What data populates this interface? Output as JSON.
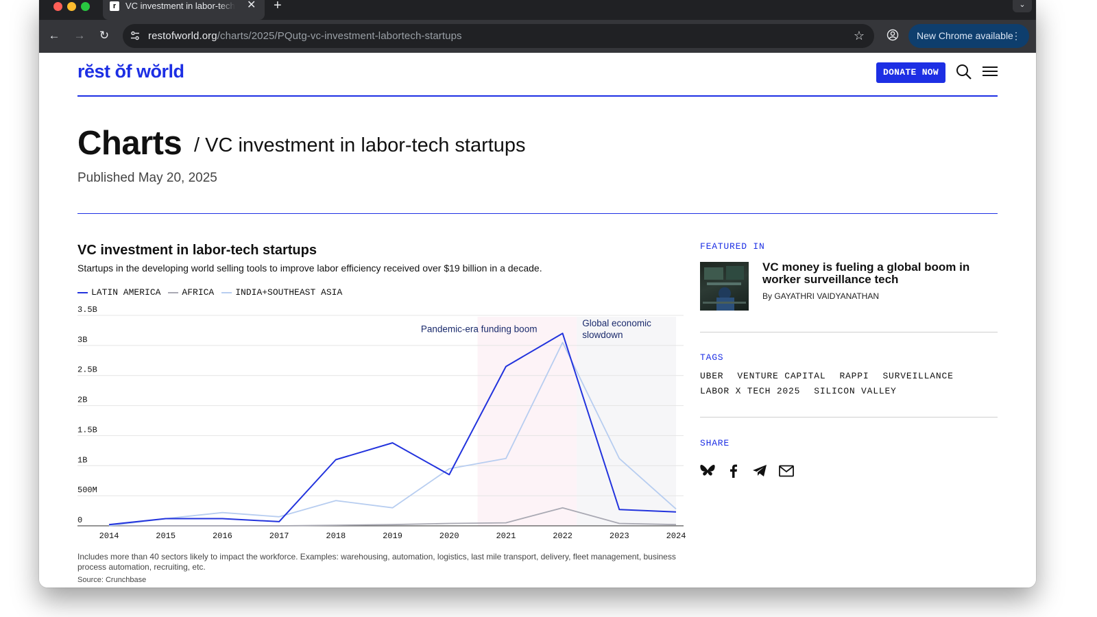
{
  "browser": {
    "tab_title": "VC investment in labor-tech startups",
    "tab_favicon": "r",
    "url_host": "restofworld.org",
    "url_path": "/charts/2025/PQutg-vc-investment-labortech-startups",
    "update_label": "New Chrome available",
    "icons": [
      "back-icon",
      "forward-icon",
      "reload-icon",
      "tune-icon",
      "star-icon",
      "profile-icon",
      "more-icon"
    ]
  },
  "site": {
    "logo": "rĕst ŏf wŏrld",
    "donate_label": "DONATE NOW",
    "icons": [
      "search-icon",
      "menu-icon"
    ],
    "brand_color": "#1d2fe4"
  },
  "header": {
    "title": "Charts",
    "subtitle": "/ VC investment in labor-tech startups",
    "published": "Published May 20, 2025"
  },
  "chart_data": {
    "type": "line",
    "title": "VC investment in labor-tech startups",
    "subtitle": "Startups in the developing world selling tools to improve labor efficiency received over $19 billion in a decade.",
    "x": [
      2014,
      2015,
      2016,
      2017,
      2018,
      2019,
      2020,
      2021,
      2022,
      2023,
      2024
    ],
    "series": [
      {
        "name": "LATIN AMERICA",
        "color": "#2233dd",
        "values": [
          0.02,
          0.12,
          0.12,
          0.07,
          1.1,
          1.38,
          0.85,
          2.65,
          3.2,
          0.27,
          0.23
        ]
      },
      {
        "name": "AFRICA",
        "color": "#a9a9b3",
        "values": [
          0.0,
          0.0,
          0.0,
          0.0,
          0.01,
          0.02,
          0.04,
          0.05,
          0.3,
          0.04,
          0.02
        ]
      },
      {
        "name": "INDIA+SOUTHEAST ASIA",
        "color": "#b7cdf0",
        "values": [
          0.0,
          0.12,
          0.22,
          0.15,
          0.42,
          0.3,
          0.95,
          1.12,
          3.05,
          1.12,
          0.28
        ]
      }
    ],
    "yticks": [
      "0",
      "500M",
      "1B",
      "1.5B",
      "2B",
      "2.5B",
      "3B",
      "3.5B"
    ],
    "ytick_values": [
      0,
      0.5,
      1.0,
      1.5,
      2.0,
      2.5,
      3.0,
      3.5
    ],
    "ylim": [
      0,
      3.5
    ],
    "xlim": [
      2014,
      2024
    ],
    "grid": true,
    "legend": "top-left",
    "annotations": [
      {
        "label": "Pandemic-era funding boom",
        "x_start": 2020.5,
        "x_end": 2022.25,
        "fill": "#fdf3f7"
      },
      {
        "label_lines": [
          "Global economic",
          "slowdown"
        ],
        "x_start": 2022.25,
        "x_end": 2024,
        "fill": "#f6f6f8"
      }
    ],
    "note": "Includes more than 40 sectors likely to impact the workforce. Examples: warehousing, automation, logistics, last mile transport, delivery, fleet management, business process automation, recruiting, etc.",
    "source": "Source: Crunchbase"
  },
  "sidebar": {
    "featured_label": "FEATURED IN",
    "featured_title": "VC money is fueling a global boom in worker surveillance tech",
    "featured_byline": "By GAYATHRI VAIDYANATHAN",
    "tags_label": "TAGS",
    "tags": [
      "UBER",
      "VENTURE CAPITAL",
      "RAPPI",
      "SURVEILLANCE",
      "LABOR X TECH 2025",
      "SILICON VALLEY"
    ],
    "share_label": "SHARE",
    "share_icons": [
      "bluesky-icon",
      "facebook-icon",
      "telegram-icon",
      "email-icon"
    ]
  }
}
